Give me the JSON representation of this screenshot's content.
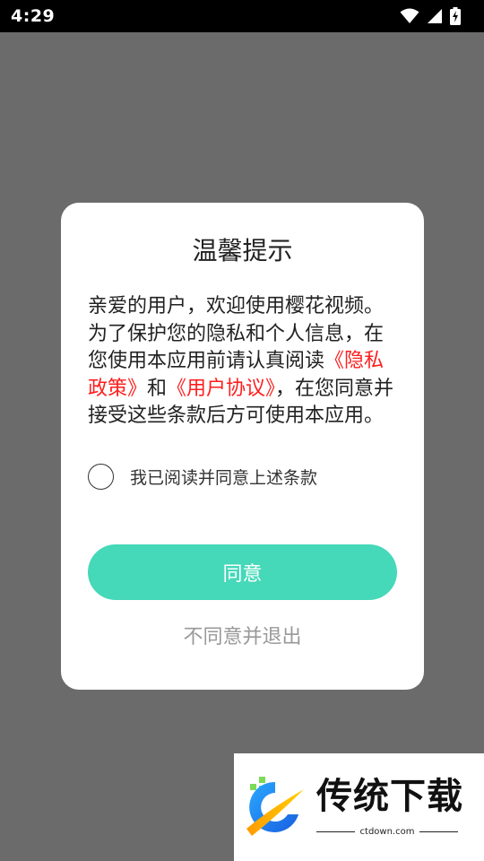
{
  "status_bar": {
    "time": "4:29",
    "icons": [
      "wifi-icon",
      "cell-signal-icon",
      "battery-charging-icon"
    ]
  },
  "dialog": {
    "title": "温馨提示",
    "body_prefix": "亲爱的用户，欢迎使用樱花视频。为了保护您的隐私和个人信息，在您使用本应用前请认真阅读",
    "privacy_link": "《隐私政策》",
    "conjunction": "和",
    "user_agreement_link": "《用户协议》",
    "body_suffix": "，在您同意并接受这些条款后方可使用本应用。",
    "checkbox_label": "我已阅读并同意上述条款",
    "checkbox_checked": false,
    "agree_button": "同意",
    "disagree_button": "不同意并退出"
  },
  "watermark": {
    "title": "传统下载",
    "url": "ctdown.com"
  },
  "colors": {
    "overlay": "#6b6b6b",
    "accent_button": "#45d8b9",
    "link_red": "#ff1e1e",
    "muted_text": "#999999"
  }
}
